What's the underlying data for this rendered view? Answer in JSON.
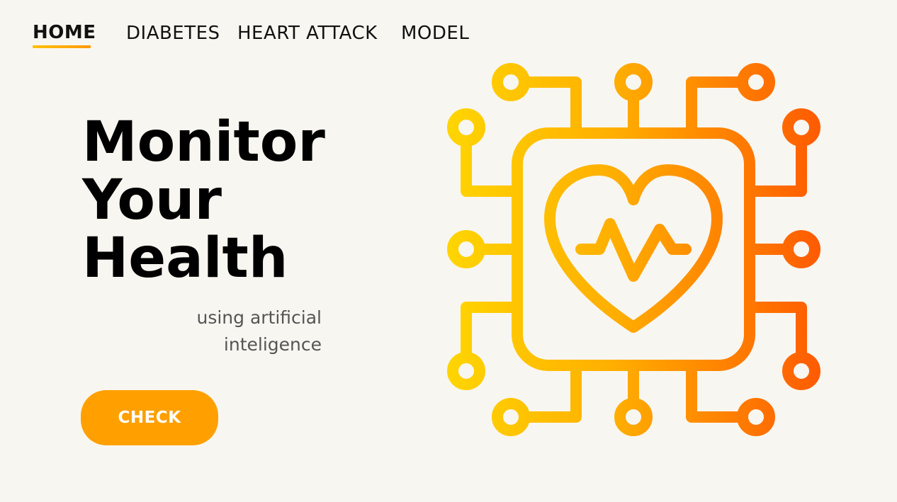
{
  "nav": {
    "items": [
      {
        "label": "HOME",
        "active": true
      },
      {
        "label": "DIABETES",
        "active": false
      },
      {
        "label": "HEART ATTACK",
        "active": false
      },
      {
        "label": "MODEL",
        "active": false
      }
    ]
  },
  "hero": {
    "title_lines": [
      "Monitor",
      "Your",
      "Health"
    ],
    "subtitle_lines": [
      "using artificial",
      "inteligence"
    ]
  },
  "cta": {
    "label": "CHECK"
  },
  "illustration": {
    "icon": "heart-chip-icon",
    "gradient": [
      "#ffd500",
      "#ffae00",
      "#ff5a00"
    ]
  },
  "colors": {
    "background": "#f8f6f0",
    "accent": "#ffa000",
    "underline": "#ffb300"
  }
}
